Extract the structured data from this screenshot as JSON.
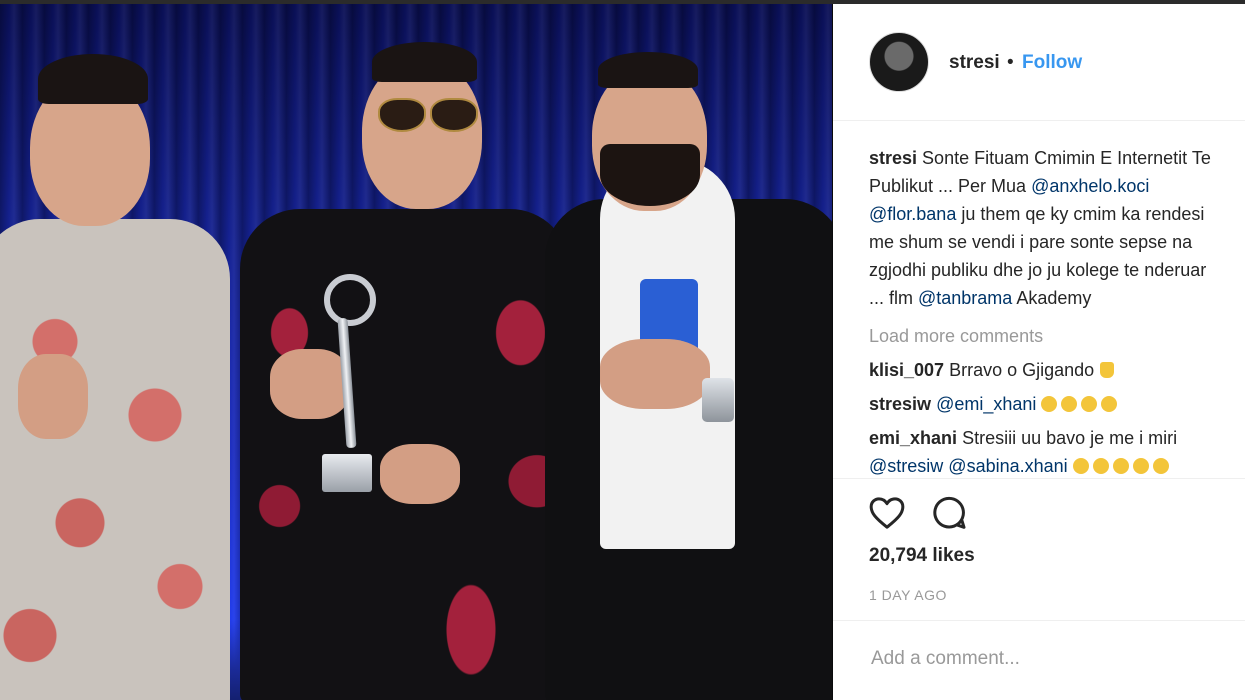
{
  "post": {
    "username": "stresi",
    "separator": "•",
    "follow_label": "Follow"
  },
  "caption": {
    "username": "stresi",
    "parts": [
      {
        "t": " Sonte Fituam Cmimin E Internetit Publikut ... Per Mua "
      },
      {
        "m": "@anxhelo.koci"
      },
      {
        "t": " "
      },
      {
        "m": "@flor.bana"
      },
      {
        "t": " ju them qe ky cmim ka rendesi me shum se vendi i pare sonte sepse na zgjodhi publiku dhe jo ju kolege te nderuar ... flm "
      },
      {
        "m": "@tanbrama"
      },
      {
        "t": " Akademy"
      }
    ],
    "lines": [
      [
        "stresi",
        " Sonte Fituam Cmimin E Internetit Te"
      ],
      [
        "",
        "Publikut ... Per Mua ",
        "@anxhelo.koci"
      ],
      [
        "",
        "",
        "@flor.bana",
        " ju them qe ky cmim ka rendesi"
      ],
      [
        "",
        "me shum se vendi i pare sonte sepse na"
      ],
      [
        "",
        "zgjodhi publiku dhe jo ju kolege te nderuar"
      ],
      [
        "",
        "... flm ",
        "@tanbrama",
        " Akademy"
      ]
    ]
  },
  "load_more_label": "Load more comments",
  "comments": [
    {
      "user": "klisi_007",
      "text": "Brravo o Gjigando",
      "emoji": "trophy-emoji"
    },
    {
      "user": "stresiw",
      "mention": "@emi_xhani",
      "emoji_count": 4
    },
    {
      "user": "emi_xhani",
      "text": "Stresiii uu bavo je me i miri"
    },
    {
      "user": "",
      "mention": "@stresiw",
      "mention2": "@sabina.xhani",
      "emoji_count": 5
    }
  ],
  "likes_label": "20,794 likes",
  "time_ago": "1 DAY AGO",
  "add_comment_placeholder": "Add a comment...",
  "icons": {
    "like": "heart-icon",
    "comment": "comment-bubble-icon"
  },
  "colors": {
    "link": "#3897f0",
    "mention": "#003569",
    "muted": "#999999",
    "text": "#262626"
  }
}
